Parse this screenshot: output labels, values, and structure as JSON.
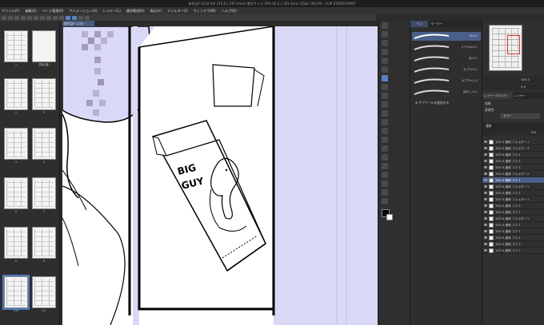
{
  "app": {
    "title": "前作品P 1234 (A4 210.0 x 297.0mm) 数字サイズ 50%  92.4 x 201.6mm  35dpi 100.0%  -  CLIP STUDIO PAINT"
  },
  "menu": [
    "ファイル(F)",
    "編集(E)",
    "ページ管理(P)",
    "アニメーション(A)",
    "レイヤー(L)",
    "選択範囲(S)",
    "表示(V)",
    "フィルター(I)",
    "ウィンドウ(W)",
    "ヘルプ(H)"
  ],
  "document_tab": "前作品P 1234",
  "page_list": {
    "pages": [
      "1",
      "2",
      "3",
      "4",
      "5",
      "6",
      "7",
      "8",
      "9",
      "10",
      "11",
      "12"
    ],
    "cover_label": "表紙(裏)",
    "selected": "124"
  },
  "artwork": {
    "box_text_line1": "BIG",
    "box_text_line2": "GUY"
  },
  "brush_panel": {
    "tabs": [
      "ペン",
      "マーカー"
    ],
    "brushes": [
      "Gペン",
      "リアルGペン",
      "丸ペン",
      "カブラペン",
      "カブラペン2",
      "ぼかしペン"
    ],
    "footer": "サブツールを追加する"
  },
  "navigator": {
    "zoom": "100.0",
    "angle": "0.0"
  },
  "layer_panel": {
    "tabs": [
      "レイヤープロパティ",
      "レイヤー"
    ],
    "blend_label": "効果",
    "mode_label": "表現色",
    "color_option": "カラー",
    "mode_value": "通常",
    "opacity": "100",
    "layers": [
      {
        "name": "100 % 通常 フォルダー 1"
      },
      {
        "name": "100 % 通常 フォルダー 3"
      },
      {
        "name": "100 % 通常 コマ 4"
      },
      {
        "name": "100 % 通常 コマ 3"
      },
      {
        "name": "100 % 通常 コマ 2"
      },
      {
        "name": "100 % 通常 フォルダー 2"
      },
      {
        "name": "100 % 通常 コマ 1"
      },
      {
        "name": "100 % 通常 フォルダー 1"
      },
      {
        "name": "100 % 通常 コマ 1"
      },
      {
        "name": "100 % 通常 フォルダー 1"
      },
      {
        "name": "100 % 通常 コマ 3"
      },
      {
        "name": "100 % 通常 コマ 2"
      },
      {
        "name": "100 % 通常 フォルダー 1"
      },
      {
        "name": "100 % 通常 コマ 2"
      },
      {
        "name": "100 % 通常 コマ 1"
      },
      {
        "name": "100 % 通常 コマ 4"
      },
      {
        "name": "100 % 通常 コマ 3"
      },
      {
        "name": "100 % 通常 コマ 2"
      }
    ],
    "selected_index": 6
  },
  "colors": {
    "canvas_bg": "#d9d9f7",
    "selection": "#4a5f8c"
  }
}
